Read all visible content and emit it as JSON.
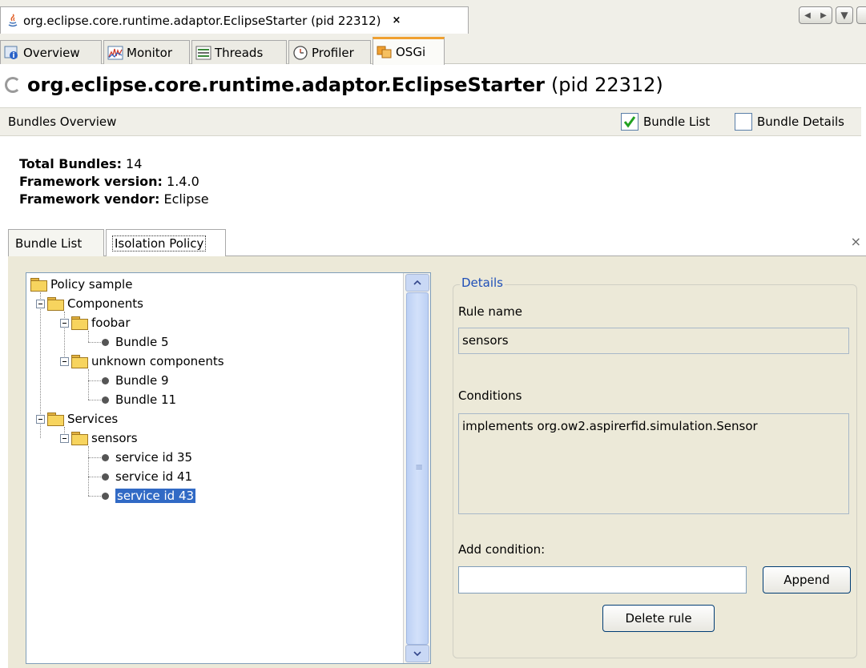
{
  "doc_tab": {
    "title": "org.eclipse.core.runtime.adaptor.EclipseStarter (pid 22312)",
    "close": "×"
  },
  "nav": {
    "prev": "◀",
    "next": "▶",
    "menu": "▼"
  },
  "view_tabs": [
    "Overview",
    "Monitor",
    "Threads",
    "Profiler",
    "OSGi"
  ],
  "header": {
    "name": "org.eclipse.core.runtime.adaptor.EclipseStarter",
    "pid": "(pid 22312)"
  },
  "subbar": {
    "label": "Bundles Overview",
    "bundle_list": "Bundle List",
    "bundle_details": "Bundle Details"
  },
  "info": {
    "total_label": "Total Bundles:",
    "total_value": " 14",
    "version_label": "Framework version:",
    "version_value": " 1.4.0",
    "vendor_label": "Framework vendor:",
    "vendor_value": " Eclipse"
  },
  "inner_tabs": [
    "Bundle List",
    "Isolation Policy"
  ],
  "inner_close": "×",
  "tree": {
    "root": "Policy sample",
    "components": "Components",
    "foobar": "foobar",
    "bundle5": "Bundle 5",
    "unknown": "unknown components",
    "bundle9": "Bundle 9",
    "bundle11": "Bundle 11",
    "services": "Services",
    "sensors": "sensors",
    "svc35": "service id 35",
    "svc41": "service id 41",
    "svc43": "service id 43"
  },
  "details": {
    "legend": "Details",
    "rule_name_label": "Rule name",
    "rule_name_value": "sensors",
    "conditions_label": "Conditions",
    "conditions_value": "implements org.ow2.aspirerfid.simulation.Sensor",
    "add_condition_label": "Add condition:",
    "add_condition_value": "",
    "append_button": "Append",
    "delete_button": "Delete rule"
  },
  "icons": {
    "doc": "java-icon",
    "overview": "info-icon",
    "monitor": "monitor-chart-icon",
    "threads": "threads-icon",
    "profiler": "clock-icon",
    "osgi": "osgi-icon",
    "check": "checkmark-icon",
    "folder": "folder-icon",
    "leaf": "bullet-icon"
  },
  "colors": {
    "selection": "#316ac5",
    "legend": "#1f4fb8",
    "panel_bg": "#ece9d8",
    "active_tab_accent": "#f0a030"
  }
}
